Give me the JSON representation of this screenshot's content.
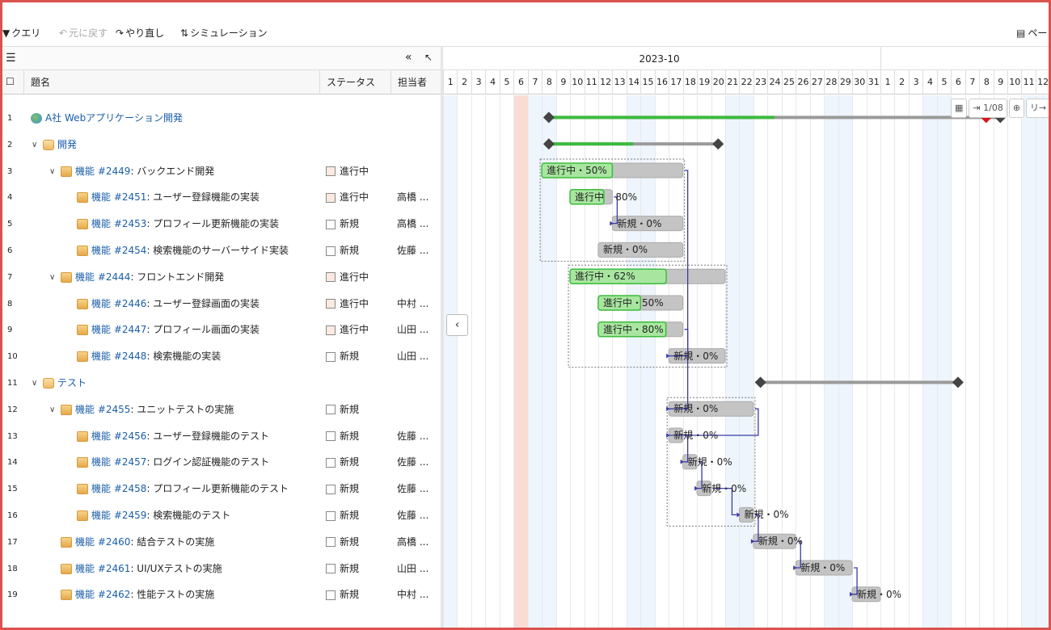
{
  "toolbar": {
    "query": "クエリ",
    "undo": "元に戻す",
    "redo": "やり直し",
    "simulation": "シミュレーション",
    "page": "ペー"
  },
  "columns": {
    "subject": "題名",
    "status": "ステータス",
    "assignee": "担当者"
  },
  "rows": [
    {
      "num": "1",
      "type": "proj",
      "indent": 0,
      "toggle": "",
      "name": "A社 Webアプリケーション開発",
      "id": "",
      "status": "",
      "st": "",
      "assignee": ""
    },
    {
      "num": "2",
      "type": "folder",
      "indent": 1,
      "toggle": "∨",
      "name": "開発",
      "id": "",
      "status": "",
      "st": "",
      "assignee": ""
    },
    {
      "num": "3",
      "type": "issue",
      "indent": 2,
      "toggle": "∨",
      "tracker": "機能",
      "id": "#2449",
      "name": "バックエンド開発",
      "status": "進行中",
      "st": "prog",
      "assignee": ""
    },
    {
      "num": "4",
      "type": "issue",
      "indent": 3,
      "toggle": "",
      "tracker": "機能",
      "id": "#2451",
      "name": "ユーザー登録機能の実装",
      "status": "進行中",
      "st": "prog",
      "assignee": "高橋 ..."
    },
    {
      "num": "5",
      "type": "issue",
      "indent": 3,
      "toggle": "",
      "tracker": "機能",
      "id": "#2453",
      "name": "プロフィール更新機能の実装",
      "status": "新規",
      "st": "new",
      "assignee": "高橋 ..."
    },
    {
      "num": "6",
      "type": "issue",
      "indent": 3,
      "toggle": "",
      "tracker": "機能",
      "id": "#2454",
      "name": "検索機能のサーバーサイド実装",
      "status": "新規",
      "st": "new",
      "assignee": "佐藤 ..."
    },
    {
      "num": "7",
      "type": "issue",
      "indent": 2,
      "toggle": "∨",
      "tracker": "機能",
      "id": "#2444",
      "name": "フロントエンド開発",
      "status": "進行中",
      "st": "prog",
      "assignee": ""
    },
    {
      "num": "8",
      "type": "issue",
      "indent": 3,
      "toggle": "",
      "tracker": "機能",
      "id": "#2446",
      "name": "ユーザー登録画面の実装",
      "status": "進行中",
      "st": "prog",
      "assignee": "中村 ..."
    },
    {
      "num": "9",
      "type": "issue",
      "indent": 3,
      "toggle": "",
      "tracker": "機能",
      "id": "#2447",
      "name": "プロフィール画面の実装",
      "status": "進行中",
      "st": "prog",
      "assignee": "山田 ..."
    },
    {
      "num": "10",
      "type": "issue",
      "indent": 3,
      "toggle": "",
      "tracker": "機能",
      "id": "#2448",
      "name": "検索機能の実装",
      "status": "新規",
      "st": "new",
      "assignee": "山田 ..."
    },
    {
      "num": "11",
      "type": "folder",
      "indent": 1,
      "toggle": "∨",
      "name": "テスト",
      "id": "",
      "status": "",
      "st": "",
      "assignee": ""
    },
    {
      "num": "12",
      "type": "issue",
      "indent": 2,
      "toggle": "∨",
      "tracker": "機能",
      "id": "#2455",
      "name": "ユニットテストの実施",
      "status": "新規",
      "st": "new",
      "assignee": ""
    },
    {
      "num": "13",
      "type": "issue",
      "indent": 3,
      "toggle": "",
      "tracker": "機能",
      "id": "#2456",
      "name": "ユーザー登録機能のテスト",
      "status": "新規",
      "st": "new",
      "assignee": "佐藤 ..."
    },
    {
      "num": "14",
      "type": "issue",
      "indent": 3,
      "toggle": "",
      "tracker": "機能",
      "id": "#2457",
      "name": "ログイン認証機能のテスト",
      "status": "新規",
      "st": "new",
      "assignee": "佐藤 ..."
    },
    {
      "num": "15",
      "type": "issue",
      "indent": 3,
      "toggle": "",
      "tracker": "機能",
      "id": "#2458",
      "name": "プロフィール更新機能のテスト",
      "status": "新規",
      "st": "new",
      "assignee": "佐藤 ..."
    },
    {
      "num": "16",
      "type": "issue",
      "indent": 3,
      "toggle": "",
      "tracker": "機能",
      "id": "#2459",
      "name": "検索機能のテスト",
      "status": "新規",
      "st": "new",
      "assignee": "佐藤 ..."
    },
    {
      "num": "17",
      "type": "issue",
      "indent": 2,
      "toggle": "",
      "tracker": "機能",
      "id": "#2460",
      "name": "結合テストの実施",
      "status": "新規",
      "st": "new",
      "assignee": "高橋 ..."
    },
    {
      "num": "18",
      "type": "issue",
      "indent": 2,
      "toggle": "",
      "tracker": "機能",
      "id": "#2461",
      "name": "UI/UXテストの実施",
      "status": "新規",
      "st": "new",
      "assignee": "山田 ..."
    },
    {
      "num": "19",
      "type": "issue",
      "indent": 2,
      "toggle": "",
      "tracker": "機能",
      "id": "#2462",
      "name": "性能テストの実施",
      "status": "新規",
      "st": "new",
      "assignee": "中村 ..."
    }
  ],
  "timeline": {
    "months": [
      "2023-10"
    ],
    "oct_days": 31,
    "nov_visible_days": 12,
    "today": "2023-10-06",
    "weekend_oct": [
      1,
      7,
      8,
      14,
      15,
      21,
      22,
      28,
      29
    ],
    "weekend_nov": [
      4,
      5,
      11,
      12
    ]
  },
  "view_tools": {
    "calendar": "calendar-icon",
    "range": "1/08",
    "zoom": "zoom-icon",
    "next": "リ→"
  },
  "colors": {
    "done": "#3dbb3d",
    "bar": "#c4c4c4",
    "done_fill": "#a8e6a0",
    "link": "#3a3aa8",
    "milestone": "#444",
    "due_marker": "#d9141e"
  },
  "bars": [
    {
      "row": 1,
      "kind": "summary",
      "start": "2023-10-08",
      "end": "2023-11-09",
      "progress": 0.5,
      "milestone_red": "2023-11-08"
    },
    {
      "row": 2,
      "kind": "summary",
      "start": "2023-10-08",
      "end": "2023-10-20",
      "progress": 0.5
    },
    {
      "row": 3,
      "kind": "task",
      "start": "2023-10-08",
      "end": "2023-10-17",
      "progress": 0.5,
      "label": "進行中・50%"
    },
    {
      "row": 4,
      "kind": "task",
      "start": "2023-10-10",
      "end": "2023-10-12",
      "progress": 0.8,
      "label": "進行中",
      "tail": "80%"
    },
    {
      "row": 5,
      "kind": "task",
      "start": "2023-10-13",
      "end": "2023-10-17",
      "progress": 0,
      "label": "新規・0%"
    },
    {
      "row": 6,
      "kind": "task",
      "start": "2023-10-12",
      "end": "2023-10-17",
      "progress": 0,
      "label": "新規・0%"
    },
    {
      "row": 7,
      "kind": "task",
      "start": "2023-10-10",
      "end": "2023-10-20",
      "progress": 0.62,
      "label": "進行中・62%"
    },
    {
      "row": 8,
      "kind": "task",
      "start": "2023-10-12",
      "end": "2023-10-17",
      "progress": 0.5,
      "label": "進行中・50%"
    },
    {
      "row": 9,
      "kind": "task",
      "start": "2023-10-12",
      "end": "2023-10-17",
      "progress": 0.8,
      "label": "進行中・80%"
    },
    {
      "row": 10,
      "kind": "task",
      "start": "2023-10-17",
      "end": "2023-10-20",
      "progress": 0,
      "label": "新規・0%"
    },
    {
      "row": 11,
      "kind": "summary",
      "start": "2023-10-23",
      "end": "2023-11-06",
      "progress": 0
    },
    {
      "row": 12,
      "kind": "task",
      "start": "2023-10-17",
      "end": "2023-10-22",
      "progress": 0,
      "label": "新規・0%"
    },
    {
      "row": 13,
      "kind": "task",
      "start": "2023-10-17",
      "end": "2023-10-17",
      "progress": 0,
      "label": "新規・0%"
    },
    {
      "row": 14,
      "kind": "task",
      "start": "2023-10-18",
      "end": "2023-10-18",
      "progress": 0,
      "label": "新規・0%"
    },
    {
      "row": 15,
      "kind": "task",
      "start": "2023-10-19",
      "end": "2023-10-19",
      "progress": 0,
      "label": "新規・0%"
    },
    {
      "row": 16,
      "kind": "task",
      "start": "2023-10-22",
      "end": "2023-10-22",
      "progress": 0,
      "label": "新規・0%"
    },
    {
      "row": 17,
      "kind": "task",
      "start": "2023-10-23",
      "end": "2023-10-25",
      "progress": 0,
      "label": "新規・0%"
    },
    {
      "row": 18,
      "kind": "task",
      "start": "2023-10-26",
      "end": "2023-10-29",
      "progress": 0,
      "label": "新規・0%"
    },
    {
      "row": 19,
      "kind": "task",
      "start": "2023-10-30",
      "end": "2023-10-31",
      "progress": 0,
      "label": "新規・0%"
    }
  ]
}
